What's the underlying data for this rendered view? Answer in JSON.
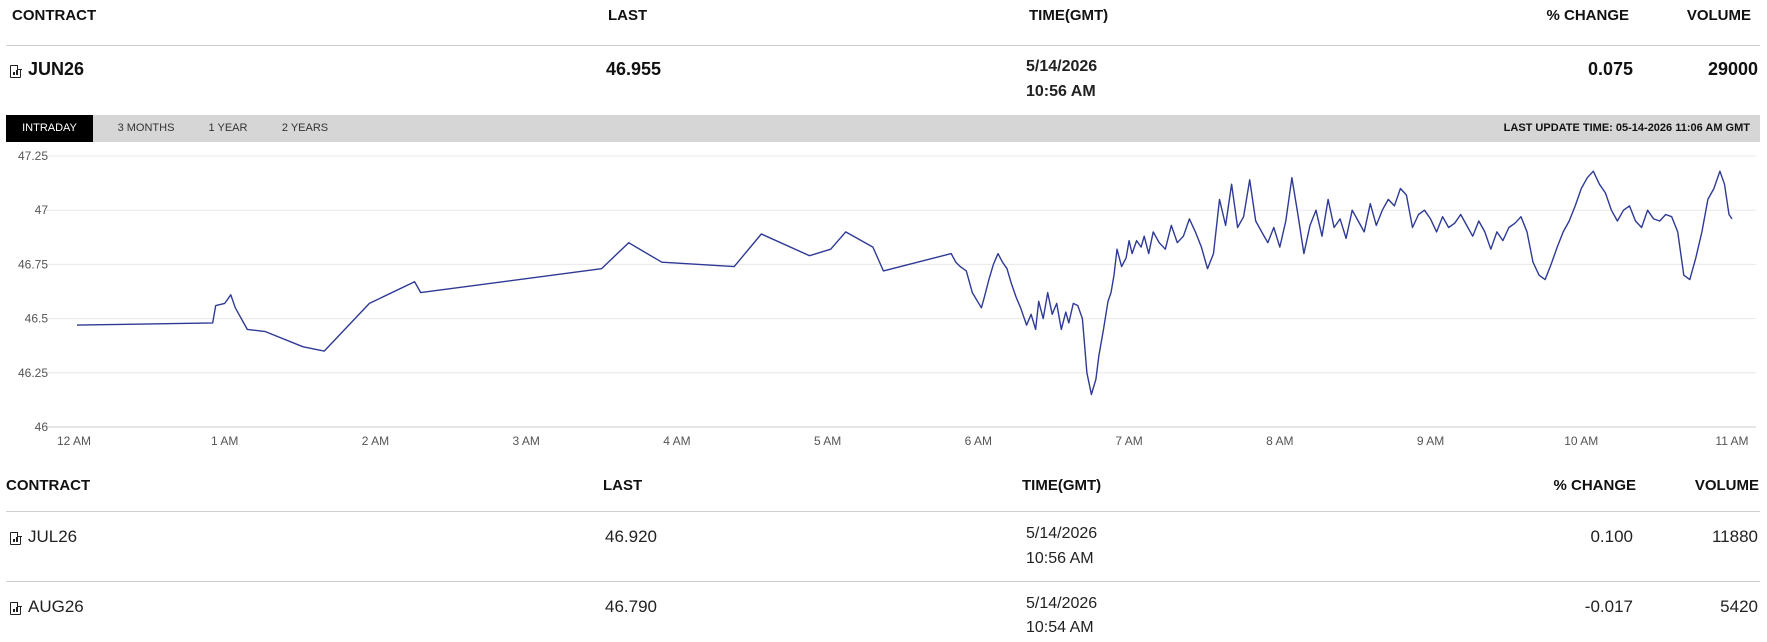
{
  "headers": {
    "contract": "CONTRACT",
    "last": "LAST",
    "time": "TIME(GMT)",
    "change": "% CHANGE",
    "volume": "VOLUME"
  },
  "featured": {
    "contract": "JUN26",
    "last": "46.955",
    "date": "5/14/2026",
    "time": "10:56 AM",
    "change": "0.075",
    "volume": "29000",
    "icon": "document-chart-icon"
  },
  "tabs": [
    {
      "label": "INTRADAY",
      "active": true
    },
    {
      "label": "3 MONTHS",
      "active": false
    },
    {
      "label": "1 YEAR",
      "active": false
    },
    {
      "label": "2 YEARS",
      "active": false
    }
  ],
  "last_update": "LAST UPDATE TIME: 05-14-2026 11:06 AM GMT",
  "rows": [
    {
      "contract": "JUL26",
      "last": "46.920",
      "date": "5/14/2026",
      "time": "10:56 AM",
      "change": "0.100",
      "volume": "11880"
    },
    {
      "contract": "AUG26",
      "last": "46.790",
      "date": "5/14/2026",
      "time": "10:54 AM",
      "change": "-0.017",
      "volume": "5420"
    }
  ],
  "colors": {
    "line": "#2e3a96",
    "grid": "#e8e8e8",
    "tabbar": "#d6d6d6",
    "active_tab": "#000000"
  },
  "chart_data": {
    "type": "line",
    "x_unit": "hours after 12 AM GMT",
    "x_ticks": [
      0,
      1,
      2,
      3,
      4,
      5,
      6,
      7,
      8,
      9,
      10,
      11
    ],
    "x_tick_labels": [
      "12 AM",
      "1 AM",
      "2 AM",
      "3 AM",
      "4 AM",
      "5 AM",
      "6 AM",
      "7 AM",
      "8 AM",
      "9 AM",
      "10 AM",
      "11 AM"
    ],
    "xlim": [
      0,
      11
    ],
    "y_ticks": [
      46,
      46.25,
      46.5,
      46.75,
      47,
      47.25
    ],
    "y_tick_labels": [
      "46",
      "46.25",
      "46.5",
      "46.75",
      "47",
      "47.25"
    ],
    "ylim": [
      46,
      47.25
    ],
    "grid": "horizontal",
    "x": [
      0.02,
      0.92,
      0.94,
      1.0,
      1.04,
      1.07,
      1.15,
      1.27,
      1.52,
      1.66,
      1.96,
      2.26,
      2.3,
      3.5,
      3.68,
      3.9,
      4.38,
      4.56,
      4.88,
      5.02,
      5.12,
      5.3,
      5.37,
      5.82,
      5.85,
      5.88,
      5.92,
      5.96,
      6.02,
      6.04,
      6.07,
      6.1,
      6.13,
      6.16,
      6.19,
      6.22,
      6.25,
      6.28,
      6.32,
      6.35,
      6.38,
      6.4,
      6.43,
      6.46,
      6.49,
      6.52,
      6.55,
      6.58,
      6.6,
      6.63,
      6.66,
      6.69,
      6.72,
      6.75,
      6.78,
      6.8,
      6.83,
      6.86,
      6.88,
      6.9,
      6.92,
      6.95,
      6.98,
      7.0,
      7.02,
      7.05,
      7.08,
      7.1,
      7.13,
      7.16,
      7.2,
      7.24,
      7.28,
      7.32,
      7.36,
      7.4,
      7.44,
      7.48,
      7.52,
      7.56,
      7.6,
      7.64,
      7.68,
      7.72,
      7.76,
      7.8,
      7.84,
      7.88,
      7.92,
      7.96,
      8.0,
      8.04,
      8.08,
      8.12,
      8.16,
      8.2,
      8.24,
      8.28,
      8.32,
      8.36,
      8.4,
      8.44,
      8.48,
      8.52,
      8.56,
      8.6,
      8.64,
      8.68,
      8.72,
      8.76,
      8.8,
      8.84,
      8.88,
      8.92,
      8.96,
      9.0,
      9.04,
      9.08,
      9.12,
      9.16,
      9.2,
      9.24,
      9.28,
      9.32,
      9.36,
      9.4,
      9.44,
      9.48,
      9.52,
      9.56,
      9.6,
      9.64,
      9.68,
      9.72,
      9.76,
      9.8,
      9.84,
      9.88,
      9.92,
      9.96,
      10.0,
      10.04,
      10.08,
      10.12,
      10.16,
      10.2,
      10.24,
      10.28,
      10.32,
      10.36,
      10.4,
      10.44,
      10.48,
      10.52,
      10.56,
      10.6,
      10.64,
      10.68,
      10.72,
      10.76,
      10.8,
      10.84,
      10.88,
      10.92,
      10.95,
      10.98,
      11.0
    ],
    "y": [
      46.47,
      46.48,
      46.56,
      46.57,
      46.61,
      46.55,
      46.45,
      46.44,
      46.37,
      46.35,
      46.57,
      46.67,
      46.62,
      46.73,
      46.85,
      46.76,
      46.74,
      46.89,
      46.79,
      46.82,
      46.9,
      46.83,
      46.72,
      46.8,
      46.76,
      46.74,
      46.72,
      46.62,
      46.55,
      46.6,
      46.68,
      46.75,
      46.8,
      46.76,
      46.73,
      46.66,
      46.6,
      46.55,
      46.47,
      46.52,
      46.45,
      46.58,
      46.5,
      46.62,
      46.52,
      46.57,
      46.45,
      46.53,
      46.48,
      46.57,
      46.56,
      46.5,
      46.25,
      46.15,
      46.22,
      46.33,
      46.45,
      46.58,
      46.62,
      46.7,
      46.82,
      46.74,
      46.78,
      46.86,
      46.8,
      46.86,
      46.83,
      46.88,
      46.8,
      46.9,
      46.85,
      46.82,
      46.93,
      46.85,
      46.88,
      46.96,
      46.9,
      46.83,
      46.73,
      46.8,
      47.05,
      46.93,
      47.12,
      46.92,
      46.97,
      47.14,
      46.95,
      46.9,
      46.85,
      46.92,
      46.83,
      46.95,
      47.15,
      46.98,
      46.8,
      46.93,
      47.0,
      46.88,
      47.05,
      46.92,
      46.96,
      46.87,
      47.0,
      46.95,
      46.9,
      47.03,
      46.93,
      47.0,
      47.05,
      47.02,
      47.1,
      47.07,
      46.92,
      46.98,
      47.0,
      46.96,
      46.9,
      46.97,
      46.92,
      46.94,
      46.98,
      46.93,
      46.88,
      46.95,
      46.9,
      46.82,
      46.9,
      46.86,
      46.92,
      46.94,
      46.97,
      46.9,
      46.76,
      46.7,
      46.68,
      46.75,
      46.83,
      46.9,
      46.95,
      47.02,
      47.1,
      47.15,
      47.18,
      47.12,
      47.08,
      47.0,
      46.95,
      47.0,
      47.02,
      46.95,
      46.92,
      47.0,
      46.96,
      46.95,
      46.98,
      46.97,
      46.9,
      46.7,
      46.68,
      46.78,
      46.9,
      47.05,
      47.1,
      47.18,
      47.12,
      46.98,
      46.96,
      47.02,
      47.02
    ]
  }
}
